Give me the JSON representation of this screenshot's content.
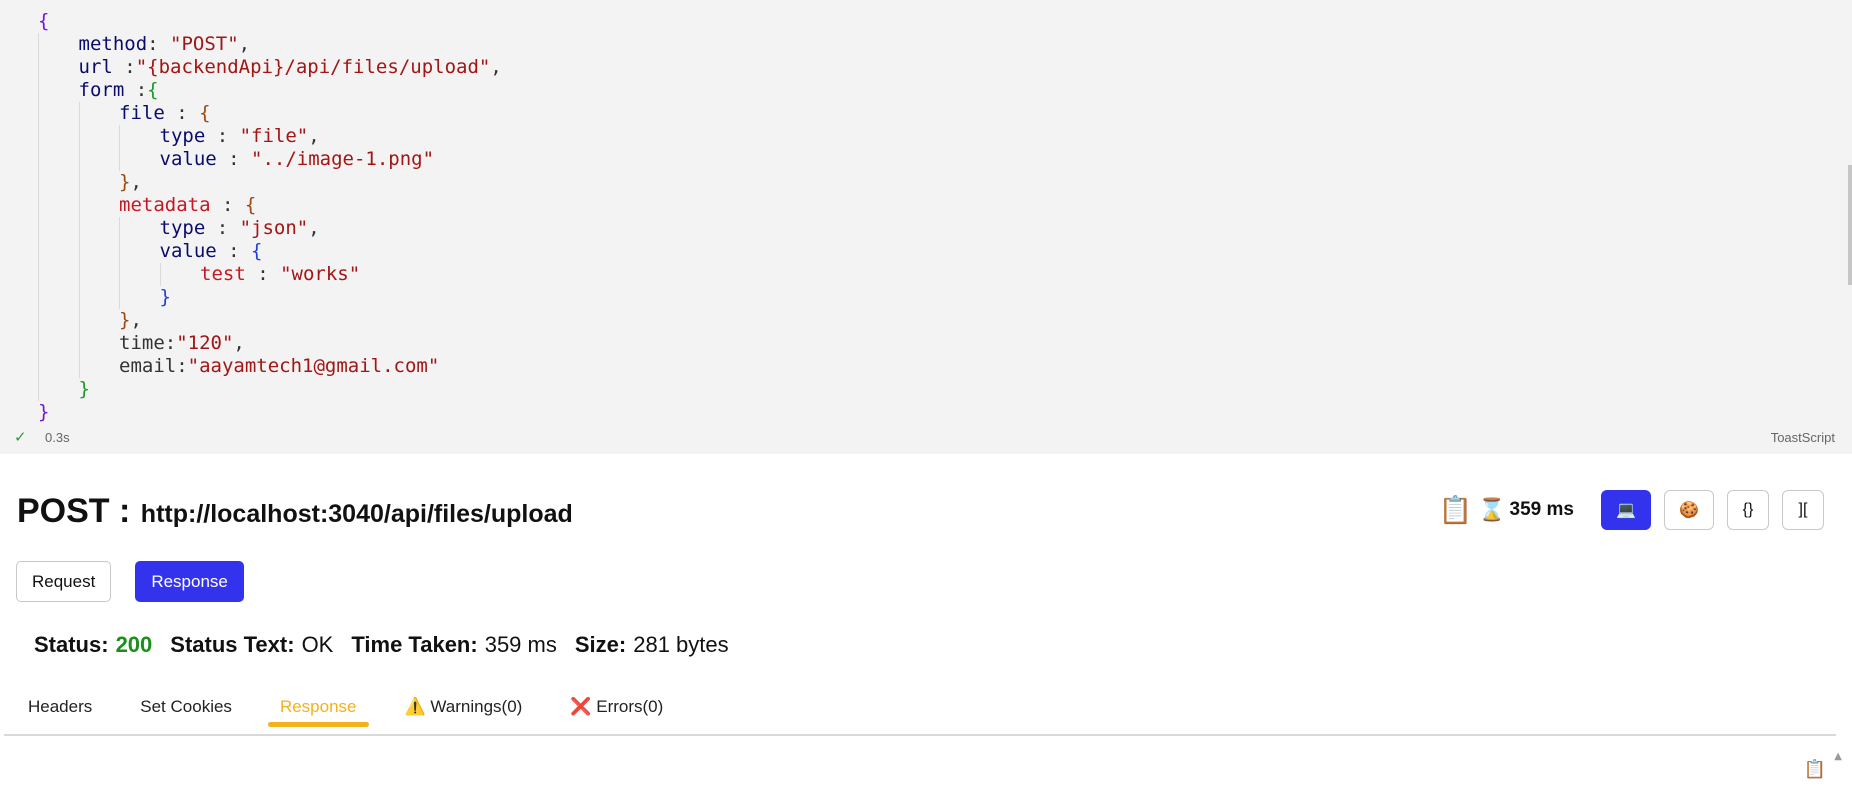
{
  "editor": {
    "lines": [
      {
        "indent": 0,
        "guides": 0,
        "tokens": [
          {
            "c": "br-purple",
            "t": "{"
          }
        ]
      },
      {
        "indent": 1,
        "guides": 1,
        "tokens": [
          {
            "c": "k",
            "t": "method"
          },
          {
            "c": "p",
            "t": ": "
          },
          {
            "c": "s",
            "t": "\"POST\""
          },
          {
            "c": "p",
            "t": ","
          }
        ]
      },
      {
        "indent": 1,
        "guides": 1,
        "tokens": [
          {
            "c": "k",
            "t": "url"
          },
          {
            "c": "p",
            "t": " :"
          },
          {
            "c": "s",
            "t": "\"{backendApi}/api/files/upload\""
          },
          {
            "c": "p",
            "t": ","
          }
        ]
      },
      {
        "indent": 1,
        "guides": 1,
        "tokens": [
          {
            "c": "k",
            "t": "form"
          },
          {
            "c": "p",
            "t": " :"
          },
          {
            "c": "br-green",
            "t": "{"
          }
        ]
      },
      {
        "indent": 2,
        "guides": 2,
        "tokens": [
          {
            "c": "k",
            "t": "file"
          },
          {
            "c": "p",
            "t": " : "
          },
          {
            "c": "br-brown",
            "t": "{"
          }
        ]
      },
      {
        "indent": 3,
        "guides": 3,
        "tokens": [
          {
            "c": "k",
            "t": "type"
          },
          {
            "c": "p",
            "t": " : "
          },
          {
            "c": "s",
            "t": "\"file\""
          },
          {
            "c": "p",
            "t": ","
          }
        ]
      },
      {
        "indent": 3,
        "guides": 3,
        "tokens": [
          {
            "c": "k",
            "t": "value"
          },
          {
            "c": "p",
            "t": " : "
          },
          {
            "c": "s",
            "t": "\"../image-1.png\""
          }
        ]
      },
      {
        "indent": 2,
        "guides": 2,
        "tokens": [
          {
            "c": "br-brown",
            "t": "}"
          },
          {
            "c": "p",
            "t": ","
          }
        ]
      },
      {
        "indent": 2,
        "guides": 2,
        "tokens": [
          {
            "c": "rk",
            "t": "metadata"
          },
          {
            "c": "p",
            "t": " : "
          },
          {
            "c": "br-brown",
            "t": "{"
          }
        ]
      },
      {
        "indent": 3,
        "guides": 3,
        "tokens": [
          {
            "c": "k",
            "t": "type"
          },
          {
            "c": "p",
            "t": " : "
          },
          {
            "c": "s",
            "t": "\"json\""
          },
          {
            "c": "p",
            "t": ","
          }
        ]
      },
      {
        "indent": 3,
        "guides": 3,
        "tokens": [
          {
            "c": "k",
            "t": "value"
          },
          {
            "c": "p",
            "t": " : "
          },
          {
            "c": "br-blue",
            "t": "{"
          }
        ]
      },
      {
        "indent": 4,
        "guides": 4,
        "tokens": [
          {
            "c": "rk",
            "t": "test"
          },
          {
            "c": "p",
            "t": " : "
          },
          {
            "c": "s",
            "t": "\"works\""
          }
        ]
      },
      {
        "indent": 3,
        "guides": 3,
        "tokens": [
          {
            "c": "br-blue",
            "t": "}"
          }
        ]
      },
      {
        "indent": 2,
        "guides": 2,
        "tokens": [
          {
            "c": "br-brown",
            "t": "}"
          },
          {
            "c": "p",
            "t": ","
          }
        ]
      },
      {
        "indent": 2,
        "guides": 2,
        "tokens": [
          {
            "c": "p",
            "t": "time:"
          },
          {
            "c": "s",
            "t": "\"120\""
          },
          {
            "c": "p",
            "t": ","
          }
        ]
      },
      {
        "indent": 2,
        "guides": 2,
        "tokens": [
          {
            "c": "p",
            "t": "email:"
          },
          {
            "c": "s",
            "t": "\"aayamtech1@gmail.com\""
          }
        ]
      },
      {
        "indent": 1,
        "guides": 1,
        "tokens": [
          {
            "c": "br-green",
            "t": "}"
          }
        ]
      },
      {
        "indent": 0,
        "guides": 0,
        "tokens": [
          {
            "c": "br-purple",
            "t": "}"
          }
        ]
      }
    ],
    "status": {
      "check": "✓",
      "exec_time": "0.3s",
      "language": "ToastScript"
    }
  },
  "request": {
    "method": "POST :",
    "url": "http://localhost:3040/api/files/upload",
    "time_taken": "359 ms",
    "toolbar": {
      "clipboard_icon": "📋",
      "hourglass_icon": "⌛",
      "terminal_button": "💻",
      "cookie_button": "🍪",
      "json_button": "{}",
      "collapse_button": "]["
    }
  },
  "view_toggle": {
    "request_label": "Request",
    "response_label": "Response",
    "active": "Response"
  },
  "status_row": {
    "status_label": "Status:",
    "status_value": "200",
    "status_text_label": "Status Text:",
    "status_text_value": "OK",
    "time_label": "Time Taken:",
    "time_value": "359 ms",
    "size_label": "Size:",
    "size_value": "281 bytes"
  },
  "tabs": [
    {
      "label": "Headers"
    },
    {
      "label": "Set Cookies"
    },
    {
      "label": "Response",
      "active": true
    },
    {
      "label": "⚠️ Warnings(0)"
    },
    {
      "label": "❌ Errors(0)"
    }
  ],
  "bottom": {
    "copy_icon": "📋",
    "scroll_up_icon": "▲"
  },
  "colors": {
    "accent": "#3333ee",
    "active_tab": "#f3b21c",
    "status_ok": "#1a8f1a"
  }
}
